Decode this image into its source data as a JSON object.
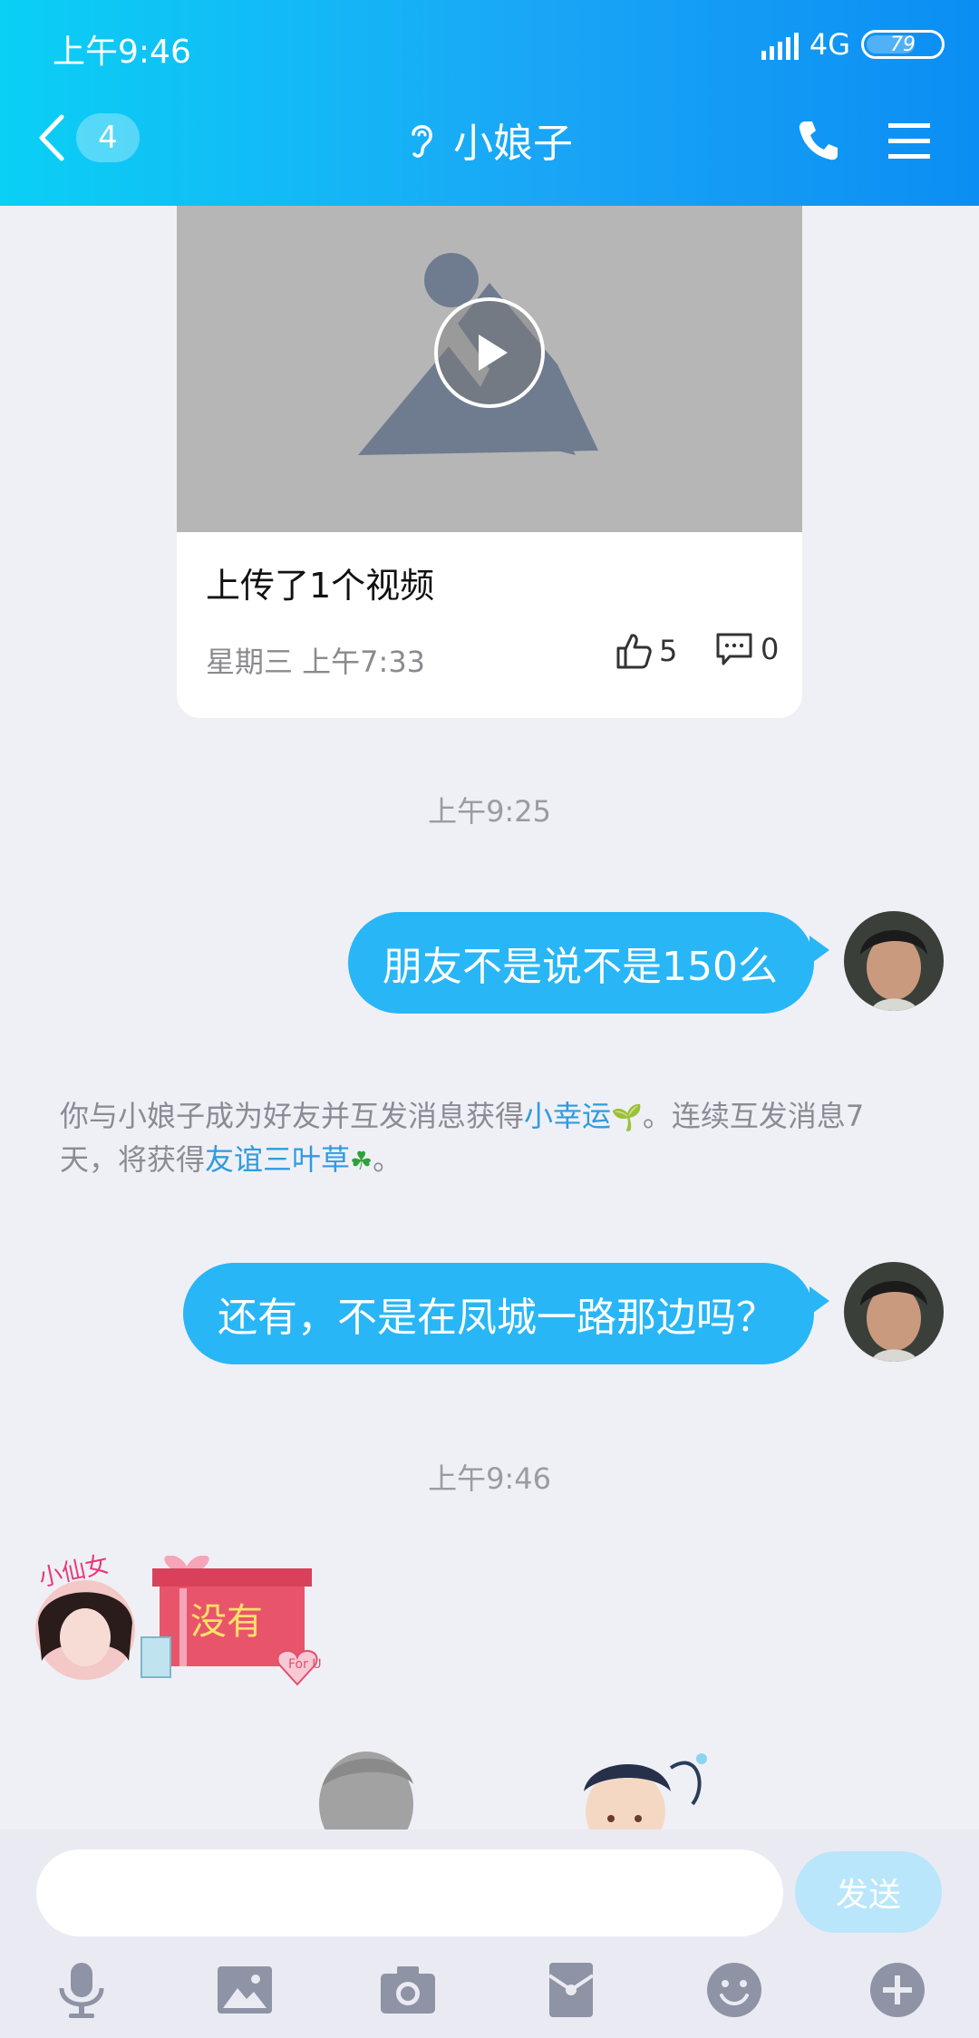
{
  "status": {
    "time": "上午9:46",
    "network": "4G",
    "battery": "79"
  },
  "header": {
    "unread_count": "4",
    "title": "小娘子"
  },
  "video_card": {
    "caption": "上传了1个视频",
    "timestamp": "星期三 上午7:33",
    "likes": "5",
    "comments": "0"
  },
  "time_separators": [
    "上午9:25",
    "上午9:46"
  ],
  "messages": [
    {
      "text": "朋友不是说不是150么"
    },
    {
      "text": "还有，不是在凤城一路那边吗？"
    }
  ],
  "system_message": {
    "part1": "你与小娘子成为好友并互发消息获得",
    "link1": "小幸运",
    "part2": "。连续互发消息7天，将获得",
    "link2": "友谊三叶草",
    "part3": "。"
  },
  "sticker": {
    "label": "没有",
    "avatar_caption": "小仙女",
    "gift_tag": "For U"
  },
  "input": {
    "placeholder": "",
    "send_label": "发送"
  },
  "toolbar": [
    "microphone-icon",
    "image-icon",
    "camera-icon",
    "red-packet-icon",
    "emoji-icon",
    "plus-icon"
  ]
}
